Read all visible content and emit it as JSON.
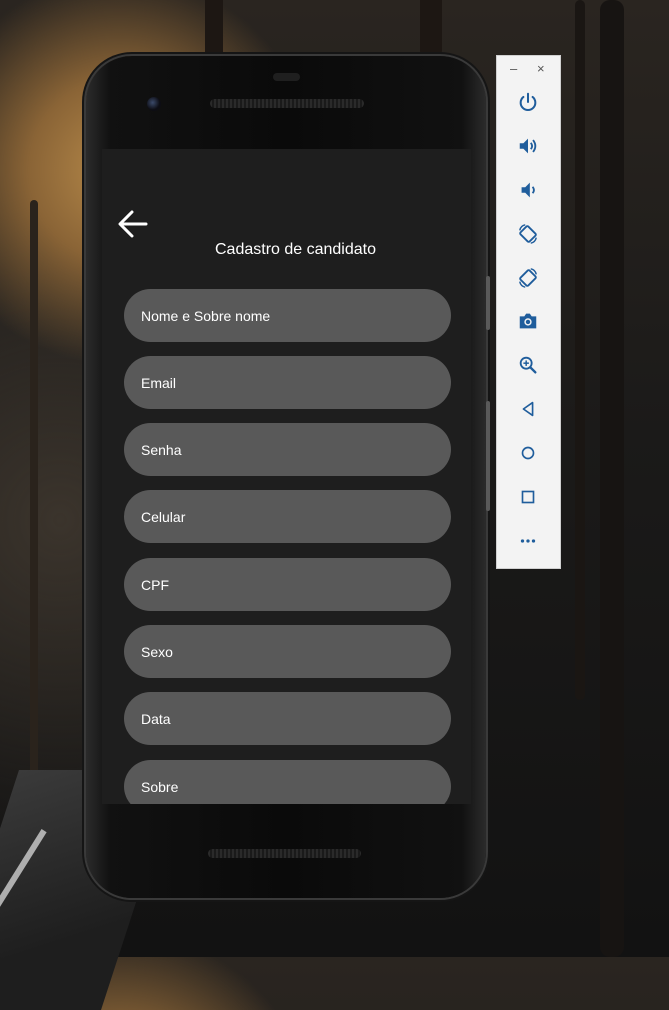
{
  "screen": {
    "title": "Cadastro de candidato",
    "back_icon": "arrow-left-icon",
    "fields": [
      {
        "placeholder": "Nome e Sobre nome",
        "value": ""
      },
      {
        "placeholder": "Email",
        "value": ""
      },
      {
        "placeholder": "Senha",
        "value": ""
      },
      {
        "placeholder": "Celular",
        "value": ""
      },
      {
        "placeholder": "CPF",
        "value": ""
      },
      {
        "placeholder": "Sexo",
        "value": ""
      },
      {
        "placeholder": "Data",
        "value": ""
      },
      {
        "placeholder": "Sobre",
        "value": ""
      }
    ]
  },
  "emulator_toolbar": {
    "minimize_label": "–",
    "close_label": "×",
    "icons": [
      "power-icon",
      "volume-up-icon",
      "volume-down-icon",
      "rotate-left-icon",
      "rotate-right-icon",
      "camera-icon",
      "zoom-icon",
      "back-icon",
      "home-icon",
      "overview-icon",
      "more-icon"
    ]
  },
  "colors": {
    "screen_bg": "#1e1e1e",
    "field_bg": "#595959",
    "text": "#ffffff",
    "toolbar_bg": "#f3f3f3",
    "toolbar_icon": "#1f5d9c"
  }
}
